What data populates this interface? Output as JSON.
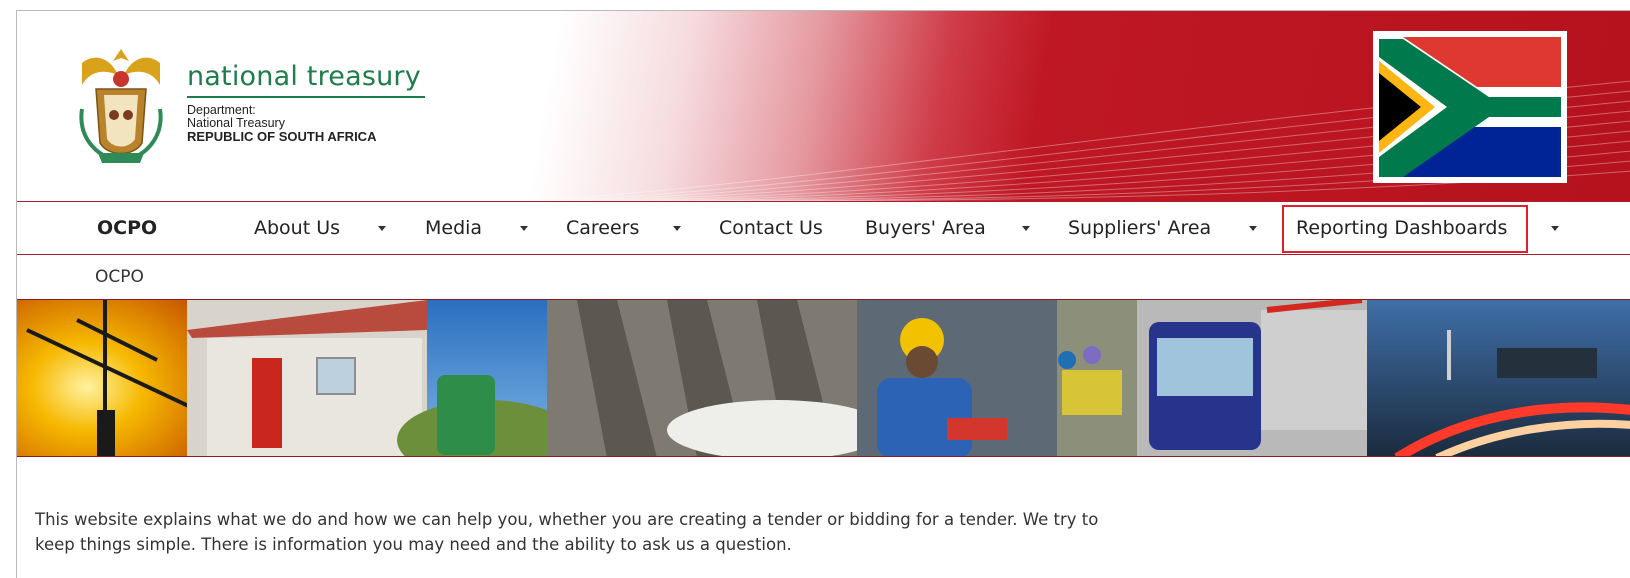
{
  "brand": {
    "name": "national treasury",
    "line1": "Department:",
    "line2": "National Treasury",
    "line3": "REPUBLIC OF SOUTH AFRICA"
  },
  "nav": {
    "home": "OCPO",
    "items": [
      {
        "label": "About Us",
        "has_dropdown": true
      },
      {
        "label": "Media",
        "has_dropdown": true
      },
      {
        "label": "Careers",
        "has_dropdown": true
      },
      {
        "label": "Contact Us",
        "has_dropdown": false
      },
      {
        "label": "Buyers' Area",
        "has_dropdown": true
      },
      {
        "label": "Suppliers' Area",
        "has_dropdown": true
      },
      {
        "label": "Reporting Dashboards",
        "has_dropdown": true
      }
    ],
    "highlight_color": "#e31f2c"
  },
  "breadcrumb": "OCPO",
  "intro": {
    "line1": "This website explains what we do and how we can help you, whether you are creating a tender or bidding for a tender. We try to",
    "line2": "keep things simple. There is  information you may need and the ability to ask us a question."
  },
  "colors": {
    "brand_green": "#1e7d4a",
    "header_red": "#b5121d",
    "nav_border": "#b01a2a"
  }
}
